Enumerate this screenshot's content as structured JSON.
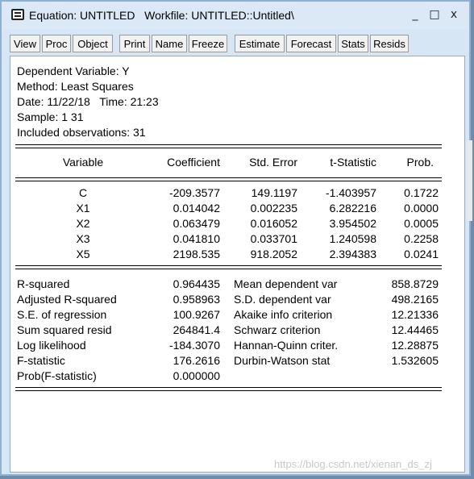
{
  "window": {
    "title": "Equation: UNTITLED   Workfile: UNTITLED::Untitled\\",
    "minimize": "_",
    "maximize": "□",
    "close": "x"
  },
  "toolbar": [
    "View",
    "Proc",
    "Object",
    "Print",
    "Name",
    "Freeze",
    "Estimate",
    "Forecast",
    "Stats",
    "Resids"
  ],
  "header": {
    "dependent": "Dependent Variable: Y",
    "method": "Method: Least Squares",
    "date": "Date: 11/22/18   Time: 21:23",
    "sample": "Sample: 1 31",
    "included": "Included observations: 31"
  },
  "columns": [
    "Variable",
    "Coefficient",
    "Std. Error",
    "t-Statistic",
    "Prob."
  ],
  "coefficients": [
    {
      "variable": "C",
      "coef": "-209.3577",
      "se": "149.1197",
      "t": "-1.403957",
      "prob": "0.1722"
    },
    {
      "variable": "X1",
      "coef": "0.014042",
      "se": "0.002235",
      "t": "6.282216",
      "prob": "0.0000"
    },
    {
      "variable": "X2",
      "coef": "0.063479",
      "se": "0.016052",
      "t": "3.954502",
      "prob": "0.0005"
    },
    {
      "variable": "X3",
      "coef": "0.041810",
      "se": "0.033701",
      "t": "1.240598",
      "prob": "0.2258"
    },
    {
      "variable": "X5",
      "coef": "2198.535",
      "se": "918.2052",
      "t": "2.394383",
      "prob": "0.0241"
    }
  ],
  "stats_left": [
    {
      "label": "R-squared",
      "value": "0.964435"
    },
    {
      "label": "Adjusted R-squared",
      "value": "0.958963"
    },
    {
      "label": "S.E. of regression",
      "value": "100.9267"
    },
    {
      "label": "Sum squared resid",
      "value": "264841.4"
    },
    {
      "label": "Log likelihood",
      "value": "-184.3070"
    },
    {
      "label": "F-statistic",
      "value": "176.2616"
    },
    {
      "label": "Prob(F-statistic)",
      "value": "0.000000"
    }
  ],
  "stats_right": [
    {
      "label": "Mean dependent var",
      "value": "858.8729"
    },
    {
      "label": "S.D. dependent var",
      "value": "498.2165"
    },
    {
      "label": "Akaike info criterion",
      "value": "12.21336"
    },
    {
      "label": "Schwarz criterion",
      "value": "12.44465"
    },
    {
      "label": "Hannan-Quinn criter.",
      "value": "12.28875"
    },
    {
      "label": "Durbin-Watson stat",
      "value": "1.532605"
    }
  ],
  "watermark": "https://blog.csdn.net/xienan_ds_zj"
}
